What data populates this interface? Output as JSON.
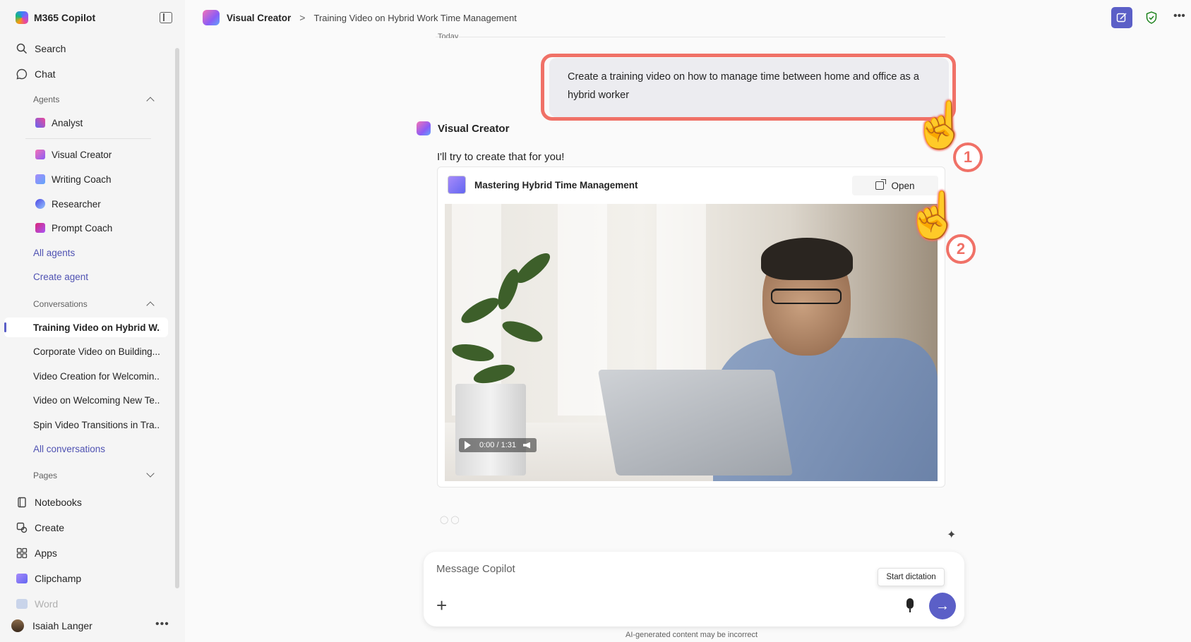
{
  "app": {
    "title": "M365 Copilot"
  },
  "sidebar": {
    "search": "Search",
    "chat": "Chat",
    "agents_label": "Agents",
    "agents": [
      {
        "label": "Analyst",
        "color": "#6366f1"
      },
      {
        "label": "Visual Creator",
        "color": "#ec4899"
      },
      {
        "label": "Writing Coach",
        "color": "#8b5cf6"
      },
      {
        "label": "Researcher",
        "color": "#4f46e5"
      },
      {
        "label": "Prompt Coach",
        "color": "#db2777"
      }
    ],
    "all_agents": "All agents",
    "create_agent": "Create agent",
    "conversations_label": "Conversations",
    "conversations": [
      "Training Video on Hybrid W...",
      "Corporate Video on Building...",
      "Video Creation for Welcomin...",
      "Video on Welcoming New Te...",
      "Spin Video Transitions in Tra..."
    ],
    "all_conversations": "All conversations",
    "pages_label": "Pages",
    "notebooks": "Notebooks",
    "create": "Create",
    "apps": "Apps",
    "clipchamp": "Clipchamp",
    "word": "Word",
    "user_name": "Isaiah Langer",
    "more": "•••"
  },
  "header": {
    "agent": "Visual Creator",
    "separator": ">",
    "conversation_title": "Training Video on Hybrid Work Time Management",
    "more": "•••"
  },
  "chat": {
    "day_label": "Today",
    "user_message": "Create a training video on how to manage time between home and office as a hybrid worker",
    "responder": "Visual Creator",
    "response_text": "I'll try to create that for you!",
    "card": {
      "title": "Mastering Hybrid Time Management",
      "open_label": "Open",
      "time": "0:00 / 1:31"
    },
    "annotations": [
      "1",
      "2"
    ]
  },
  "composer": {
    "placeholder": "Message Copilot",
    "tooltip": "Start dictation",
    "disclaimer": "AI-generated content may be incorrect"
  },
  "colors": {
    "accent": "#5b5fc7",
    "highlight": "#f07167"
  }
}
